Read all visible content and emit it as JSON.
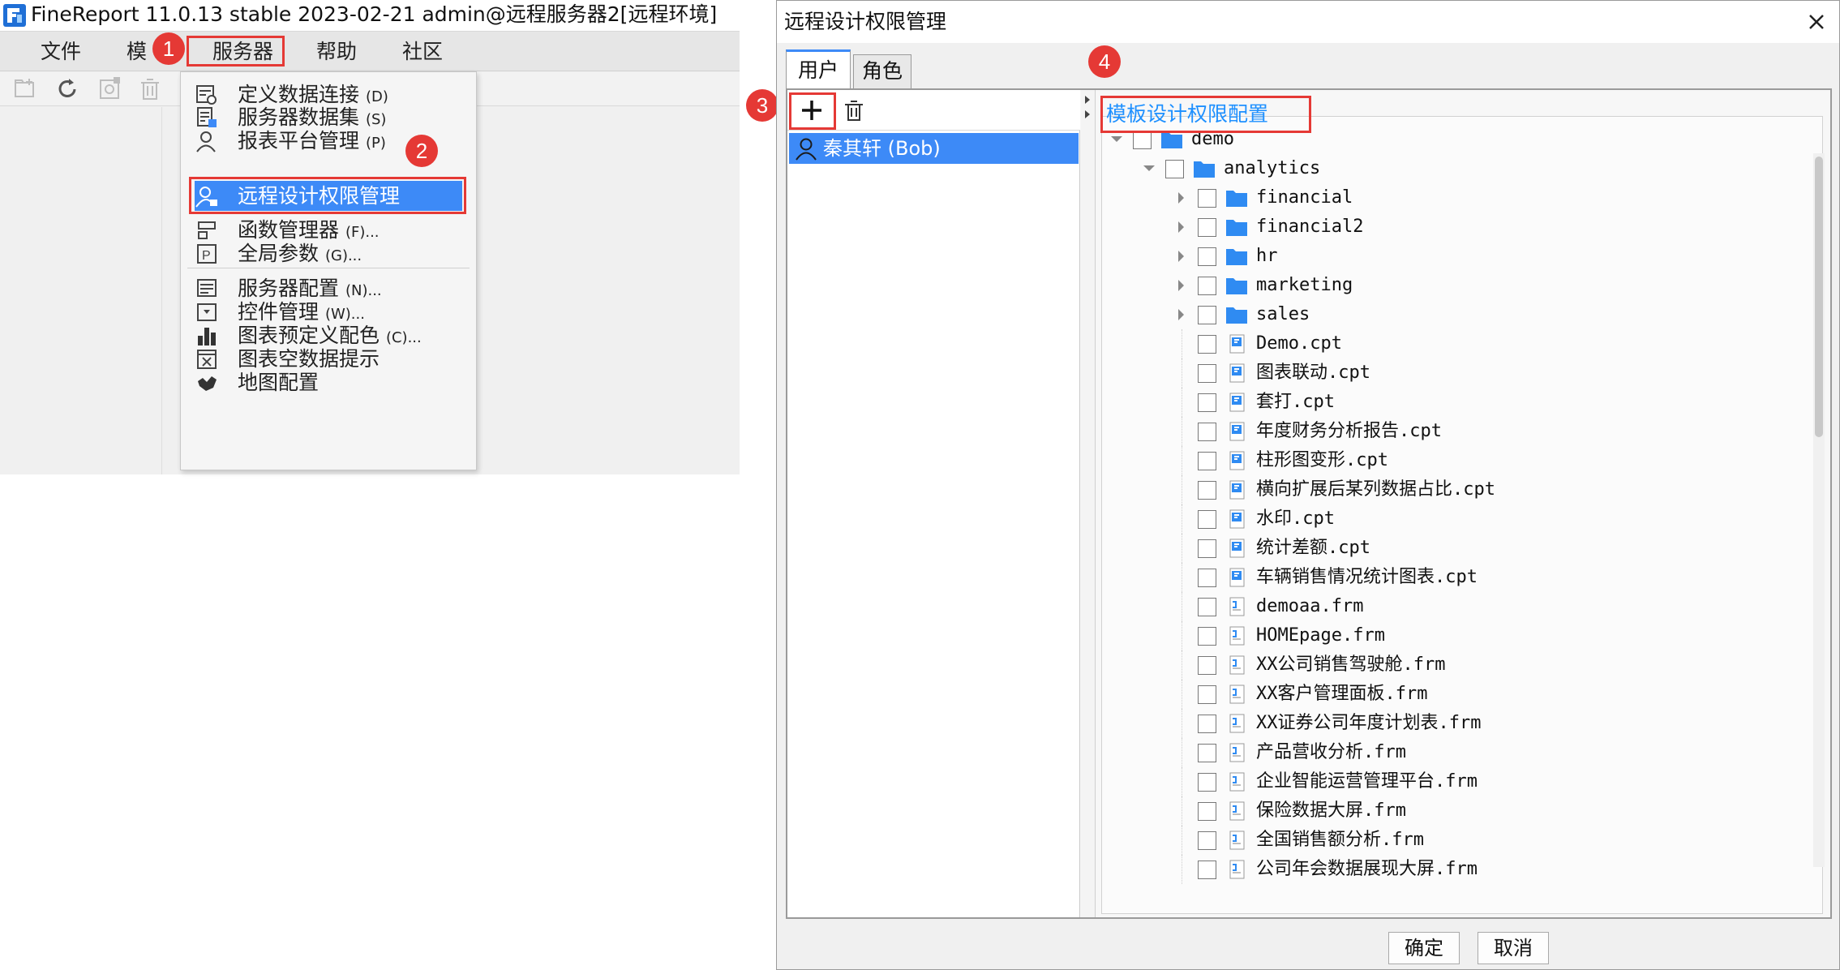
{
  "designer": {
    "title": "FineReport 11.0.13 stable 2023-02-21 admin@远程服务器2[远程环境]",
    "menu": [
      "文件",
      "模板",
      "服务器",
      "帮助",
      "社区"
    ],
    "toolbar_icons": [
      "new-folder-icon",
      "refresh-icon",
      "settings-icon",
      "delete-icon"
    ]
  },
  "server_menu": {
    "items": [
      {
        "label": "定义数据连接",
        "shortcut": "(D)",
        "icon": "data-connection-icon"
      },
      {
        "label": "服务器数据集",
        "shortcut": "(S)",
        "icon": "server-dataset-icon"
      },
      {
        "label": "报表平台管理",
        "shortcut": "(P)",
        "icon": "platform-user-icon"
      },
      {
        "label": "远程设计权限管理",
        "shortcut": "",
        "icon": "remote-permission-icon"
      },
      {
        "label": "函数管理器",
        "shortcut": "(F)...",
        "icon": "function-manager-icon"
      },
      {
        "label": "全局参数",
        "shortcut": "(G)...",
        "icon": "global-param-icon"
      },
      {
        "label": "服务器配置",
        "shortcut": "(N)...",
        "icon": "server-config-icon"
      },
      {
        "label": "控件管理",
        "shortcut": "(W)...",
        "icon": "widget-manager-icon"
      },
      {
        "label": "图表预定义配色",
        "shortcut": "(C)...",
        "icon": "chart-color-icon"
      },
      {
        "label": "图表空数据提示",
        "shortcut": "",
        "icon": "chart-empty-icon"
      },
      {
        "label": "地图配置",
        "shortcut": "",
        "icon": "map-config-icon"
      }
    ]
  },
  "steps": [
    "1",
    "2",
    "3",
    "4"
  ],
  "dialog": {
    "title": "远程设计权限管理",
    "tabs": [
      "用户",
      "角色"
    ],
    "user": "秦其轩 (Bob)",
    "section_title": "模板设计权限配置",
    "tree": [
      {
        "label": "demo",
        "type": "folder",
        "level": 0,
        "expander": "open"
      },
      {
        "label": "analytics",
        "type": "folder",
        "level": 1,
        "expander": "open"
      },
      {
        "label": "financial",
        "type": "folder",
        "level": 2,
        "expander": "closed"
      },
      {
        "label": "financial2",
        "type": "folder",
        "level": 2,
        "expander": "closed"
      },
      {
        "label": "hr",
        "type": "folder",
        "level": 2,
        "expander": "closed"
      },
      {
        "label": "marketing",
        "type": "folder",
        "level": 2,
        "expander": "closed"
      },
      {
        "label": "sales",
        "type": "folder",
        "level": 2,
        "expander": "closed"
      },
      {
        "label": "Demo.cpt",
        "type": "cpt",
        "level": 2,
        "expander": "none"
      },
      {
        "label": "图表联动.cpt",
        "type": "cpt",
        "level": 2,
        "expander": "none"
      },
      {
        "label": "套打.cpt",
        "type": "cpt",
        "level": 2,
        "expander": "none"
      },
      {
        "label": "年度财务分析报告.cpt",
        "type": "cpt",
        "level": 2,
        "expander": "none"
      },
      {
        "label": "柱形图变形.cpt",
        "type": "cpt",
        "level": 2,
        "expander": "none"
      },
      {
        "label": "横向扩展后某列数据占比.cpt",
        "type": "cpt",
        "level": 2,
        "expander": "none"
      },
      {
        "label": "水印.cpt",
        "type": "cpt",
        "level": 2,
        "expander": "none"
      },
      {
        "label": "统计差额.cpt",
        "type": "cpt",
        "level": 2,
        "expander": "none"
      },
      {
        "label": "车辆销售情况统计图表.cpt",
        "type": "cpt",
        "level": 2,
        "expander": "none"
      },
      {
        "label": "demoaa.frm",
        "type": "frm",
        "level": 2,
        "expander": "none"
      },
      {
        "label": "HOMEpage.frm",
        "type": "frm",
        "level": 2,
        "expander": "none"
      },
      {
        "label": "XX公司销售驾驶舱.frm",
        "type": "frm",
        "level": 2,
        "expander": "none"
      },
      {
        "label": "XX客户管理面板.frm",
        "type": "frm",
        "level": 2,
        "expander": "none"
      },
      {
        "label": "XX证券公司年度计划表.frm",
        "type": "frm",
        "level": 2,
        "expander": "none"
      },
      {
        "label": "产品营收分析.frm",
        "type": "frm",
        "level": 2,
        "expander": "none"
      },
      {
        "label": "企业智能运营管理平台.frm",
        "type": "frm",
        "level": 2,
        "expander": "none"
      },
      {
        "label": "保险数据大屏.frm",
        "type": "frm",
        "level": 2,
        "expander": "none"
      },
      {
        "label": "全国销售额分析.frm",
        "type": "frm",
        "level": 2,
        "expander": "none"
      },
      {
        "label": "公司年会数据展现大屏.frm",
        "type": "frm",
        "level": 2,
        "expander": "none"
      }
    ],
    "buttons": {
      "ok": "确定",
      "cancel": "取消"
    }
  },
  "colors": {
    "accent": "#3d8af7",
    "highlight_box": "#e53935",
    "folder": "#2f8bf2",
    "link": "#1e90ff"
  }
}
